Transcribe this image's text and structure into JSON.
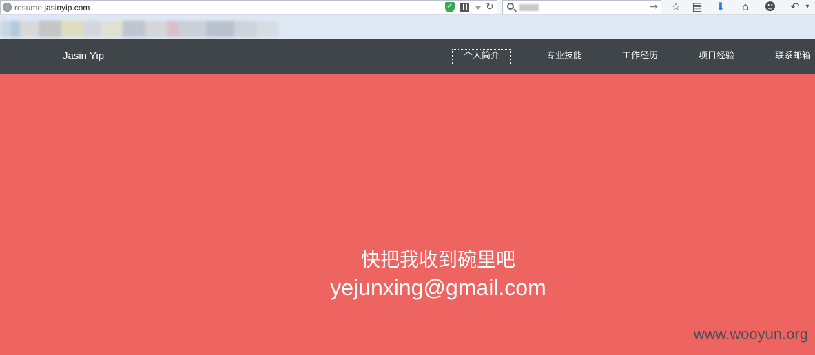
{
  "browser": {
    "url_prefix": "resume.",
    "url_host": "jasinyip.com",
    "icons": [
      "globe-icon",
      "shield-check-icon",
      "qr-code-icon",
      "dropdown-icon",
      "reload-icon",
      "search-icon",
      "go-arrow-icon",
      "star-icon",
      "reader-icon",
      "download-icon",
      "home-icon",
      "chat-icon",
      "back-icon"
    ]
  },
  "site": {
    "brand": "Jasin Yip",
    "nav": [
      {
        "label": "个人简介",
        "active": true
      },
      {
        "label": "专业技能",
        "active": false
      },
      {
        "label": "工作经历",
        "active": false
      },
      {
        "label": "项目经验",
        "active": false
      },
      {
        "label": "联系邮箱",
        "active": false
      }
    ]
  },
  "hero": {
    "heading": "快把我收到碗里吧",
    "email": "yejunxing@gmail.com",
    "background": "#ed6461"
  },
  "watermark": "www.wooyun.org"
}
